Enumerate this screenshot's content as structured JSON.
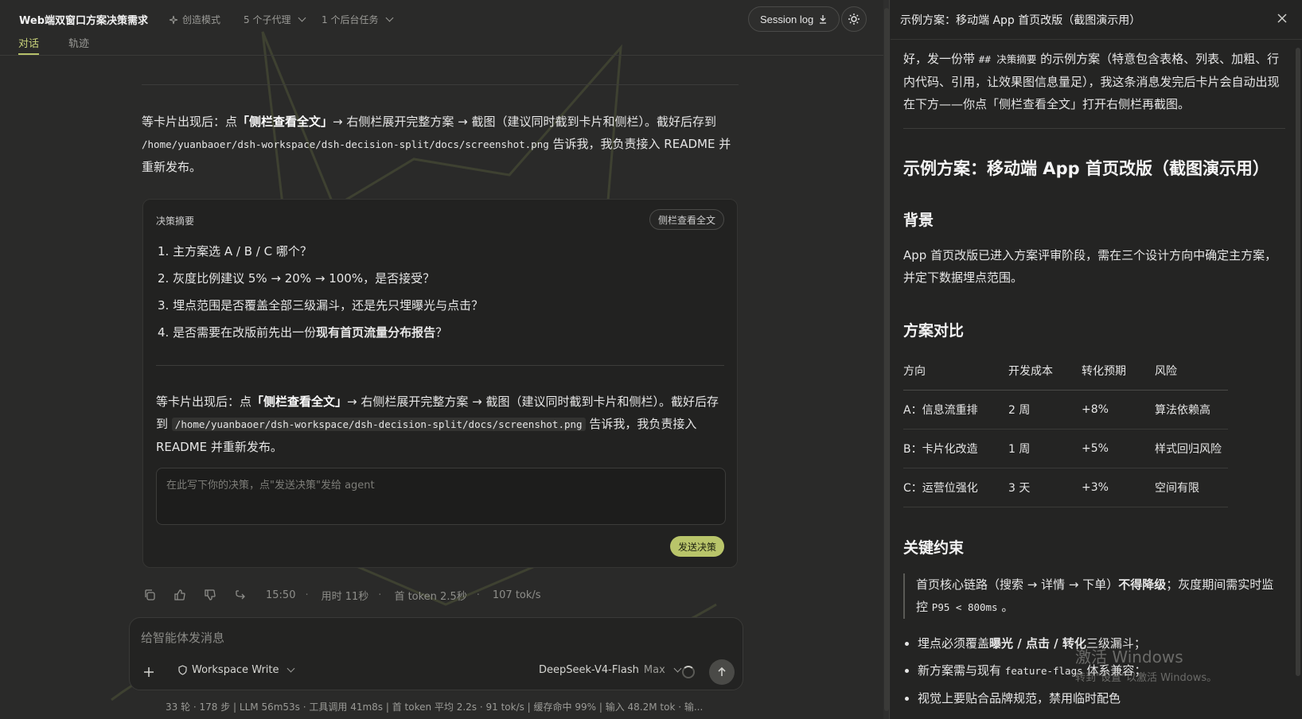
{
  "header": {
    "title": "Web端双窗口方案决策需求",
    "mode": "创造模式",
    "subagents": "5 个子代理",
    "background_tasks": "1 个后台任务",
    "session_log": "Session log"
  },
  "tabs": [
    {
      "label": "对话"
    },
    {
      "label": "轨迹"
    }
  ],
  "chat": {
    "message_pre": "等卡片出现后：点",
    "message_bold": "「侧栏查看全文」",
    "message_mid": "→ 右侧栏展开完整方案 → 截图（建议同时截到卡片和侧栏）。截好后存到",
    "message_path": "/home/yuanbaoer/dsh-workspace/dsh-decision-split/docs/screenshot.png",
    "message_post": "告诉我，我负责接入 README 并重新发布。"
  },
  "card": {
    "title": "决策摘要",
    "sidebar_button": "侧栏查看全文",
    "items": [
      {
        "text": "1. 主方案选 A / B / C 哪个？",
        "bold": ""
      },
      {
        "text": "2. 灰度比例建议 5% → 20% → 100%，是否接受？",
        "bold": ""
      },
      {
        "text": "3. 埋点范围是否覆盖全部三级漏斗，还是先只埋曝光与点击？",
        "bold": ""
      },
      {
        "text": "4. 是否需要在改版前先出一份",
        "bold": "现有首页流量分布报告",
        "suffix": "？"
      }
    ],
    "body_pre": "等卡片出现后：点",
    "body_bold": "「侧栏查看全文」",
    "body_mid": "→ 右侧栏展开完整方案 → 截图（建议同时截到卡片和侧栏）。截好后存到",
    "body_path": "/home/yuanbaoer/dsh-workspace/dsh-decision-split/docs/screenshot.png",
    "body_post": "告诉我，我负责接入 README 并重新发布。",
    "input_placeholder": "在此写下你的决策，点\"发送决策\"发给 agent",
    "send_button": "发送决策"
  },
  "message_meta": {
    "time": "15:50",
    "duration": "用时 11秒",
    "first_token": "首 token 2.5秒",
    "speed": "107 tok/s",
    "sep": "·"
  },
  "composer": {
    "placeholder": "给智能体发消息",
    "workspace": "Workspace Write",
    "model": "DeepSeek-V4-Flash",
    "model_mode": "Max"
  },
  "statusbar": {
    "text": "33 轮 · 178 步   |   LLM 56m53s · 工具调用 41m8s   |   首 token 平均 2.2s · 91 tok/s   |   缓存命中 99%   |   输入 48.2M tok · 输..."
  },
  "sidebar": {
    "title": "示例方案：移动端 App 首页改版（截图演示用）",
    "intro_pre": "好，发一份带",
    "intro_code": "## 决策摘要",
    "intro_post": "的示例方案（特意包含表格、列表、加粗、行内代码、引用，让效果图信息量足），我这条消息发完后卡片会自动出现在下方——你点「侧栏查看全文」打开右侧栏再截图。",
    "doc_title": "示例方案：移动端 App 首页改版（截图演示用）",
    "background_title": "背景",
    "background_text": "App 首页改版已进入方案评审阶段，需在三个设计方向中确定主方案，并定下数据埋点范围。",
    "compare_title": "方案对比",
    "table": {
      "headers": [
        "方向",
        "开发成本",
        "转化预期",
        "风险"
      ],
      "rows": [
        [
          "A：信息流重排",
          "2 周",
          "+8%",
          "算法依赖高"
        ],
        [
          "B：卡片化改造",
          "1 周",
          "+5%",
          "样式回归风险"
        ],
        [
          "C：运营位强化",
          "3 天",
          "+3%",
          "空间有限"
        ]
      ]
    },
    "constraints_title": "关键约束",
    "quote_pre": "首页核心链路（搜索 → 详情 → 下单）",
    "quote_bold": "不得降级",
    "quote_mid": "；灰度期间需实时监控",
    "quote_code": "P95 < 800ms",
    "quote_post": "。",
    "list": [
      {
        "pre": "埋点必须覆盖",
        "bold": "曝光 / 点击 / 转化",
        "post": "三级漏斗；"
      },
      {
        "pre": "新方案需与现有",
        "code": "feature-flags",
        "post": "体系兼容；"
      },
      {
        "pre": "视觉上要贴合品牌规范，禁用临时配色",
        "post": ""
      }
    ]
  },
  "watermark": {
    "line1": "激活 Windows",
    "line2": "转到\"设置\"以激活 Windows。"
  },
  "colors": {
    "accent": "#b9c56a",
    "background": "#2a2a29",
    "panel": "#242423"
  }
}
